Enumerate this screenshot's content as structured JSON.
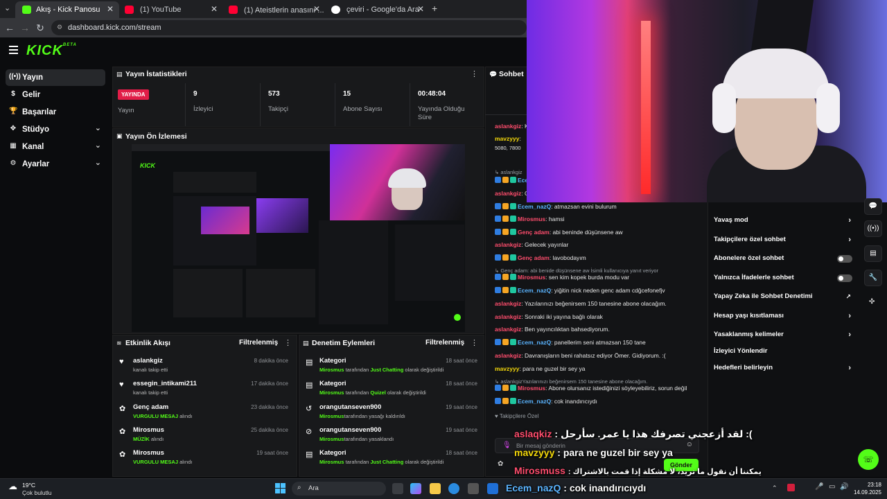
{
  "browser": {
    "tabs": [
      {
        "title": "Akış - Kick Panosu",
        "active": true
      },
      {
        "title": "(1) YouTube"
      },
      {
        "title": "(1) Ateistlerin anasını ... 😂😂"
      },
      {
        "title": "çeviri - Google'da Ara"
      }
    ],
    "url": "dashboard.kick.com/stream"
  },
  "app": {
    "logo": "KICK",
    "logo_badge": "BETA",
    "sidebar": [
      {
        "label": "Yayın",
        "icon": "stream-icon",
        "active": true
      },
      {
        "label": "Gelir",
        "icon": "money-icon"
      },
      {
        "label": "Başarılar",
        "icon": "trophy-icon"
      },
      {
        "label": "Stüdyo",
        "icon": "studio-icon",
        "expandable": true
      },
      {
        "label": "Kanal",
        "icon": "channel-icon",
        "expandable": true
      },
      {
        "label": "Ayarlar",
        "icon": "gear-icon",
        "expandable": true
      }
    ]
  },
  "stats": {
    "title": "Yayın İstatistikleri",
    "live_badge": "YAYINDA",
    "live_label": "Yayın",
    "items": [
      {
        "value": "9",
        "label": "İzleyici"
      },
      {
        "value": "573",
        "label": "Takipçi"
      },
      {
        "value": "15",
        "label": "Abone Sayısı"
      },
      {
        "value": "00:48:04",
        "label": "Yayında Olduğu Süre"
      }
    ]
  },
  "preview": {
    "title": "Yayın Ön İzlemesi"
  },
  "activity": {
    "title": "Etkinlik Akışı",
    "filter": "Filtrelenmiş",
    "rows": [
      {
        "icon": "heart-icon",
        "name": "aslankgiz",
        "sub_pre": "",
        "sub_hl": "",
        "sub_post": "kanalı takip etti",
        "time": "8 dakika önce"
      },
      {
        "icon": "heart-icon",
        "name": "essegin_intikami211",
        "sub_pre": "",
        "sub_hl": "",
        "sub_post": "kanalı takip etti",
        "time": "17 dakika önce"
      },
      {
        "icon": "gift-icon",
        "name": "Genç adam",
        "sub_pre": "",
        "sub_hl": "VURGULU MESAJ",
        "sub_post": " alındı",
        "time": "23 dakika önce"
      },
      {
        "icon": "gift-icon",
        "name": "Mirosmus",
        "sub_pre": "",
        "sub_hl": "MÜZİK",
        "sub_post": " alındı",
        "time": "25 dakika önce"
      },
      {
        "icon": "gift-icon",
        "name": "Mirosmus",
        "sub_pre": "",
        "sub_hl": "VURGULU MESAJ",
        "sub_post": " alındı",
        "time": "19 saat önce"
      }
    ]
  },
  "moderation": {
    "title": "Denetim Eylemleri",
    "filter": "Filtrelenmiş",
    "rows": [
      {
        "icon": "category-icon",
        "name": "Kategori",
        "sub_pre": "Mirosmus",
        "sub_mid": " tarafından ",
        "sub_hl": "Just Chatting",
        "sub_post": " olarak değiştirildi",
        "time": "18 saat önce"
      },
      {
        "icon": "category-icon",
        "name": "Kategori",
        "sub_pre": "Mirosmus",
        "sub_mid": " tarafından ",
        "sub_hl": "Quizel",
        "sub_post": " olarak değiştirildi",
        "time": "18 saat önce"
      },
      {
        "icon": "unban-icon",
        "name": "orangutanseven900",
        "sub_pre": "Mirosmus",
        "sub_mid": "tarafından yasağı kaldırıldı",
        "sub_hl": "",
        "sub_post": "",
        "time": "19 saat önce"
      },
      {
        "icon": "ban-icon",
        "name": "orangutanseven900",
        "sub_pre": "Mirosmus",
        "sub_mid": "tarafından yasaklandı",
        "sub_hl": "",
        "sub_post": "",
        "time": "19 saat önce"
      },
      {
        "icon": "category-icon",
        "name": "Kategori",
        "sub_pre": "Mirosmus",
        "sub_mid": " tarafından ",
        "sub_hl": "Just Chatting",
        "sub_post": " olarak değiştirildi",
        "time": "18 saat önce"
      }
    ]
  },
  "chat": {
    "title": "Sohbet",
    "lines": [
      {
        "user": "aslankgiz",
        "color": "#ff4d6d",
        "msg": ": K"
      },
      {
        "user": "mavzyyy",
        "color": "#f5d90a",
        "msg": ":"
      },
      {
        "user": "",
        "color": "#e8e8e8",
        "msg": "5080, 7800"
      },
      {
        "user": "",
        "color": "#9aa0a6",
        "msg": "↳ aslankgiz"
      },
      {
        "user": "Ecem_nazQ",
        "color": "#5ab4ff",
        "msg": ":"
      },
      {
        "user": "aslankgiz",
        "color": "#ff4d6d",
        "msg": ": G"
      },
      {
        "user": "Ecem_nazQ",
        "color": "#5ab4ff",
        "msg": ": atmazsan evini bulurum"
      },
      {
        "user": "Mirosmus",
        "color": "#ff4d6d",
        "msg": ": hamsi"
      },
      {
        "user": "Genç adam",
        "color": "#ff4d6d",
        "msg": ": abi beninde düşünsene aw"
      },
      {
        "user": "aslankgiz",
        "color": "#ff4d6d",
        "msg": ": Gelecek yayınlar"
      },
      {
        "user": "Genç adam",
        "color": "#ff4d6d",
        "msg": ": lavobodayım"
      },
      {
        "user": "",
        "color": "#9aa0a6",
        "msg": "↳ Genç adam: abi benide düşünsene aw İsimli kullanıcıya yanıt veriyor"
      },
      {
        "user": "Mirosmus",
        "color": "#ff4d6d",
        "msg": ": sen kim kopek burda modu var"
      },
      {
        "user": "Ecem_nazQ",
        "color": "#5ab4ff",
        "msg": ": yiğitin nick neden genc adam cdğcefonefjv"
      },
      {
        "user": "aslankgiz",
        "color": "#ff4d6d",
        "msg": ": Yazılarınızı beğenirsem 150 tanesine abone olacağım."
      },
      {
        "user": "aslankgiz",
        "color": "#ff4d6d",
        "msg": ": Sonraki iki yayına bağlı olarak"
      },
      {
        "user": "aslankgiz",
        "color": "#ff4d6d",
        "msg": ": Ben yayıncılıktan bahsediyorum."
      },
      {
        "user": "Ecem_nazQ",
        "color": "#5ab4ff",
        "msg": ": panellerim seni atmazsan 150 tane"
      },
      {
        "user": "aslankgiz",
        "color": "#ff4d6d",
        "msg": ": Davranışların beni rahatsız ediyor Ömer. Gidiyorum. :("
      },
      {
        "user": "mavzyyy",
        "color": "#f5d90a",
        "msg": ": para ne guzel bir sey ya"
      },
      {
        "user": "",
        "color": "#9aa0a6",
        "msg": "↳ aslankgizYazılarınızı beğenirsem 150 tanesine abone olacağım."
      },
      {
        "user": "Mirosmus",
        "color": "#ff4d6d",
        "msg": ": Abone olursanız istediğinizi söyleyebiliriz, sorun değil"
      },
      {
        "user": "Ecem_nazQ",
        "color": "#5ab4ff",
        "msg": ": cok inandırıcıydı"
      }
    ],
    "followers_only": "Takipçilere Özel",
    "input_placeholder": "Bir mesaj gönderin",
    "send_label": "Gönder"
  },
  "settings_menu": [
    {
      "label": "Yavaş mod",
      "kind": "arrow"
    },
    {
      "label": "Takipçilere özel sohbet",
      "kind": "arrow"
    },
    {
      "label": "Abonelere özel sohbet",
      "kind": "toggle"
    },
    {
      "label": "Yalnızca İfadelerle sohbet",
      "kind": "toggle"
    },
    {
      "label": "Yapay Zeka ile Sohbet Denetimi",
      "kind": "ext"
    },
    {
      "label": "Hesap yaşı kısıtlaması",
      "kind": "arrow"
    },
    {
      "label": "Yasaklanmış kelimeler",
      "kind": "arrow"
    },
    {
      "label": "İzleyici Yönlendir",
      "kind": "none"
    },
    {
      "label": "Hedefleri belirleyin",
      "kind": "arrow"
    }
  ],
  "overlay": {
    "line1_user": "aslaqkiz",
    "line1_msg": ": لقد أزعجني تصرفك هذا يا عمر. سأرحل :(",
    "line2_user": "mavzyyy",
    "line2_msg": ": para ne guzel bir sey ya",
    "line3_user": "Mirosmuss",
    "line3_msg": ": يمكننا أن نقول ما تريد، لا مشكلة إذا قمت بالاشتراك",
    "line4_user": "Ecem_nazQ",
    "line4_msg": ": cok inandırıcıydı"
  },
  "taskbar": {
    "weather_temp": "19°C",
    "weather_desc": "Çok bulutlu",
    "search": "Ara",
    "time": "23:18",
    "date": "14.09.2025"
  }
}
